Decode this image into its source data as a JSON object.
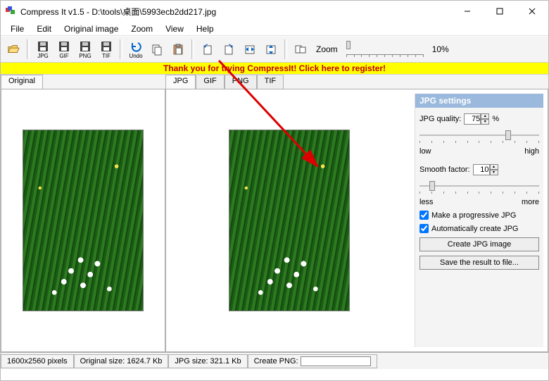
{
  "window": {
    "title": "Compress It v1.5 - D:\\tools\\桌面\\5993ecb2dd217.jpg"
  },
  "menu": {
    "file": "File",
    "edit": "Edit",
    "original": "Original image",
    "zoom": "Zoom",
    "view": "View",
    "help": "Help"
  },
  "toolbar": {
    "open": "",
    "jpg": "JPG",
    "gif": "GIF",
    "png": "PNG",
    "tif": "TIF",
    "undo": "Undo",
    "zoom_label": "Zoom",
    "zoom_value": "10%"
  },
  "banner": {
    "text": "Thank you for trying CompressIt! Click here to register!"
  },
  "tabs": {
    "original": "Original",
    "jpg": "JPG",
    "gif": "GIF",
    "png": "PNG",
    "tif": "TIF"
  },
  "settings": {
    "header": "JPG settings",
    "quality_label": "JPG quality:",
    "quality_value": "75",
    "quality_unit": "%",
    "quality_low": "low",
    "quality_high": "high",
    "smooth_label": "Smooth factor:",
    "smooth_value": "10",
    "smooth_less": "less",
    "smooth_more": "more",
    "progressive": "Make a progressive JPG",
    "auto_create": "Automatically create JPG",
    "create_btn": "Create JPG image",
    "save_btn": "Save the result to file..."
  },
  "status": {
    "dimensions": "1600x2560 pixels",
    "original_size": "Original size: 1624.7 Kb",
    "jpg_size": "JPG size: 321.1 Kb",
    "create_png": "Create PNG:"
  }
}
